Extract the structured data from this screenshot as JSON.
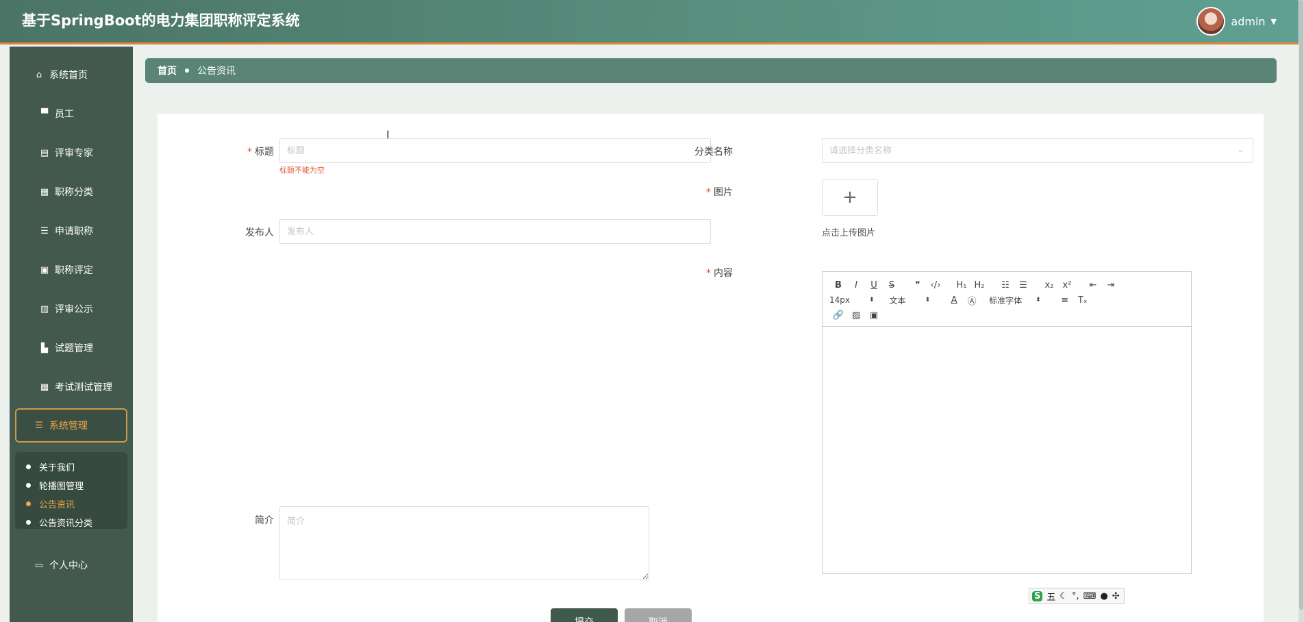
{
  "header": {
    "title": "基于SpringBoot的电力集团职称评定系统",
    "username": "admin"
  },
  "sidebar": {
    "items": [
      {
        "label": "系统首页",
        "icon": "home-icon"
      },
      {
        "label": "员工",
        "icon": "monitor-icon"
      },
      {
        "label": "评审专家",
        "icon": "clipboard-icon"
      },
      {
        "label": "职称分类",
        "icon": "grid-icon"
      },
      {
        "label": "申请职称",
        "icon": "list-icon"
      },
      {
        "label": "职称评定",
        "icon": "briefcase-icon"
      },
      {
        "label": "评审公示",
        "icon": "clipboard-check-icon"
      },
      {
        "label": "试题管理",
        "icon": "book-icon"
      },
      {
        "label": "考试测试管理",
        "icon": "grid-icon"
      },
      {
        "label": "系统管理",
        "icon": "list-icon"
      },
      {
        "label": "个人中心",
        "icon": "card-icon"
      }
    ],
    "submenu": [
      {
        "label": "关于我们"
      },
      {
        "label": "轮播图管理"
      },
      {
        "label": "公告资讯"
      },
      {
        "label": "公告资讯分类"
      }
    ]
  },
  "breadcrumb": {
    "home": "首页",
    "current": "公告资讯"
  },
  "form": {
    "title_label": "标题",
    "title_placeholder": "标题",
    "title_error": "标题不能为空",
    "category_label": "分类名称",
    "category_placeholder": "请选择分类名称",
    "publisher_label": "发布人",
    "publisher_placeholder": "发布人",
    "image_label": "图片",
    "upload_tip": "点击上传图片",
    "content_label": "内容",
    "intro_label": "简介",
    "intro_placeholder": "简介",
    "submit": "提交",
    "cancel": "取消"
  },
  "editor": {
    "font_size": "14px",
    "block_format": "文本",
    "font_family": "标准字体"
  },
  "ime": {
    "mode": "五"
  }
}
